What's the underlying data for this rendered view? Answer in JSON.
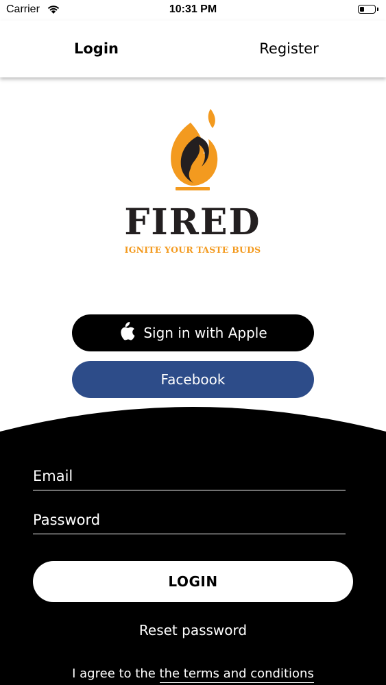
{
  "status_bar": {
    "carrier": "Carrier",
    "time": "10:31 PM",
    "wifi_icon": "wifi-icon",
    "battery_icon": "battery-icon",
    "battery_level": 0.3
  },
  "tabs": [
    {
      "label": "Login",
      "active": true
    },
    {
      "label": "Register",
      "active": false
    }
  ],
  "logo": {
    "wordmark": "FIRED",
    "tagline": "IGNITE YOUR TASTE BUDS",
    "icon": "flame-torch-icon",
    "colors": {
      "flame": "#f39a1f",
      "dark": "#231f20"
    }
  },
  "social": {
    "apple_label": "Sign in with Apple",
    "apple_icon": "apple-icon",
    "facebook_label": "Facebook"
  },
  "form": {
    "email_placeholder": "Email",
    "password_placeholder": "Password",
    "login_label": "LOGIN",
    "reset_label": "Reset password",
    "terms_prefix": "I agree to the ",
    "terms_link": "the terms and conditions"
  },
  "colors": {
    "facebook": "#2d4c89",
    "panel": "#000000",
    "accent": "#f39a1f"
  }
}
